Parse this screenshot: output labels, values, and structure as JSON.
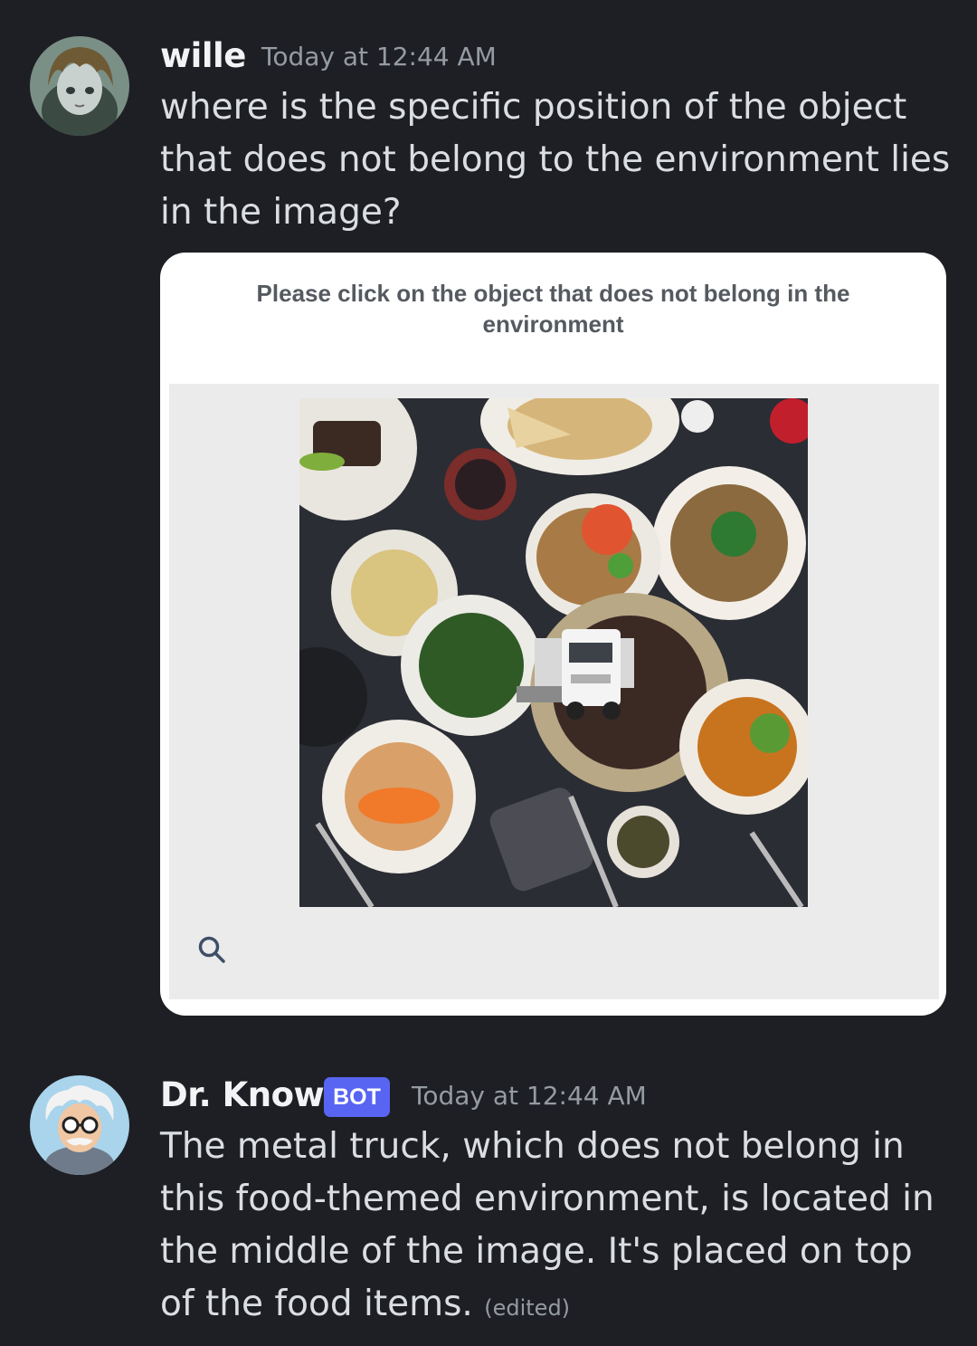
{
  "messages": [
    {
      "username": "wille",
      "timestamp": "Today at 12:44 AM",
      "text": "where is the specific position of the object that does not belong to the environment lies in the image?",
      "avatar": "anime-character-avatar",
      "attachment": {
        "title": "Please click on the object that does not belong in the environment",
        "image": "food-table-with-truck-photo",
        "icon": "search-icon"
      }
    },
    {
      "username": "Dr. Know",
      "badge": "BOT",
      "timestamp": "Today at 12:44 AM",
      "text": "The metal truck, which does not belong in this food-themed environment, is located in the middle of the image. It's placed on top of the food items.",
      "edited": "(edited)",
      "avatar": "scientist-avatar"
    }
  ],
  "colors": {
    "background": "#1e1f24",
    "username": "#f2f3f5",
    "text": "#dbdee1",
    "timestamp": "#959ba3",
    "badge": "#5865f2"
  }
}
